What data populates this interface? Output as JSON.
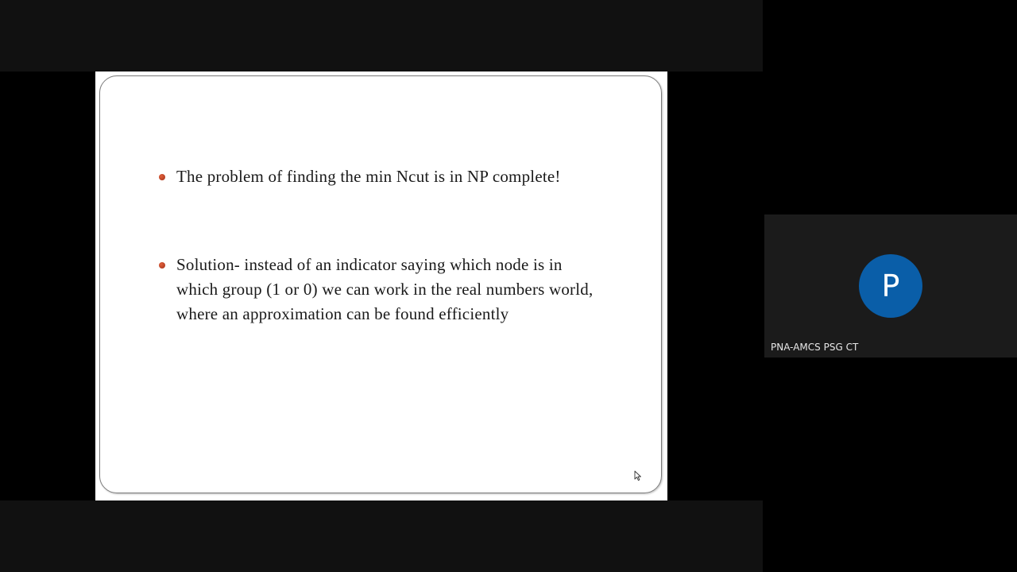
{
  "slide": {
    "bullets": [
      {
        "text": "The problem of finding the min Ncut is in NP complete!"
      },
      {
        "text": "Solution- instead of an indicator saying which node is in which group (1 or 0) we can work in the real numbers world, where an approximation can be found efficiently"
      }
    ],
    "bullet_color": "#c0401f",
    "icons": {
      "cursor": "mouse-pointer-icon"
    }
  },
  "participant": {
    "avatar_letter": "P",
    "name": "PNA-AMCS PSG CT",
    "avatar_color": "#0a5ea8"
  }
}
